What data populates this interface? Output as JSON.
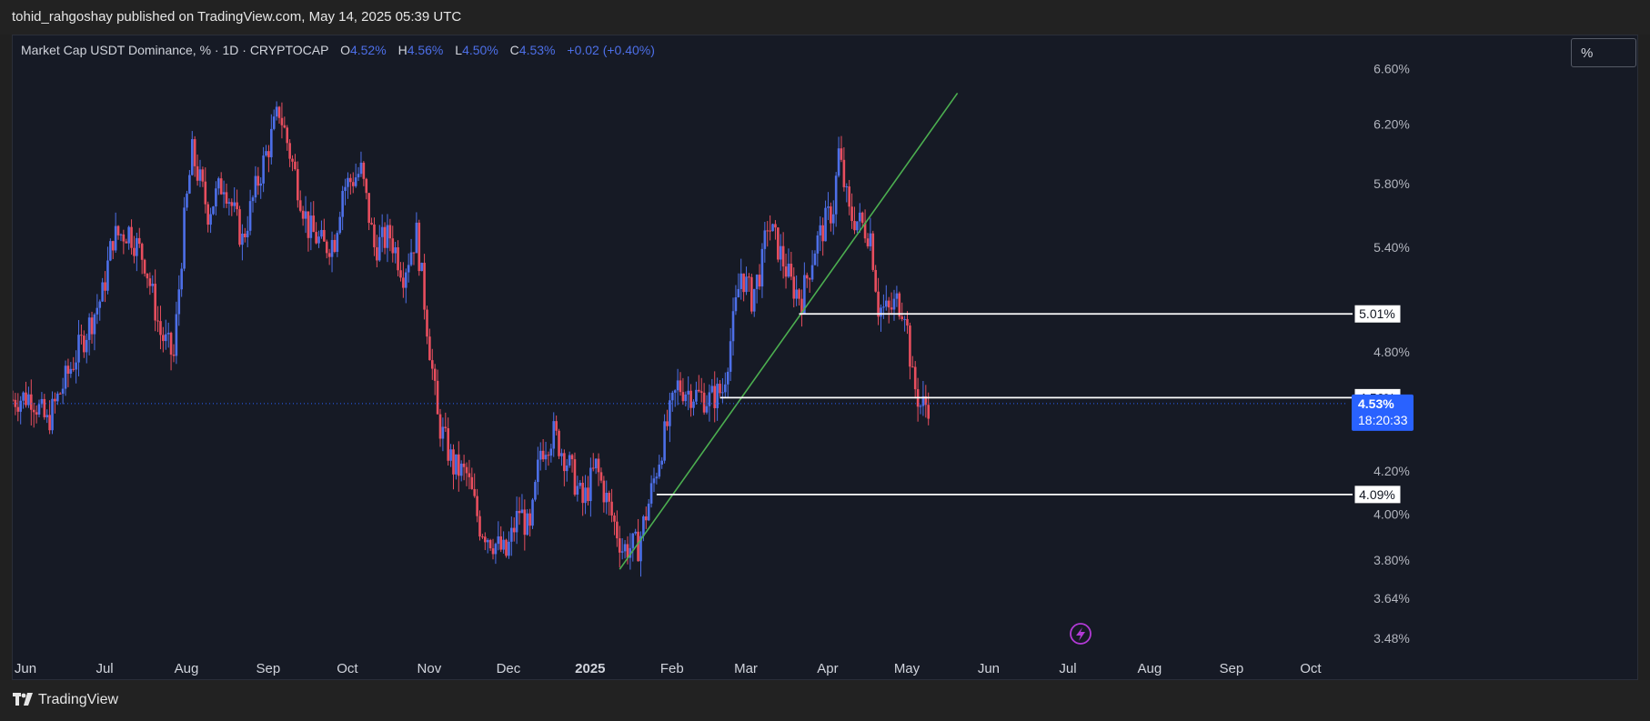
{
  "header": {
    "published": "tohid_rahgoshay published on TradingView.com, May 14, 2025 05:39 UTC"
  },
  "legend": {
    "symbol": "Market Cap USDT Dominance, % · 1D · CRYPTOCAP",
    "open_label": "O",
    "open": "4.52%",
    "high_label": "H",
    "high": "4.56%",
    "low_label": "L",
    "low": "4.50%",
    "close_label": "C",
    "close": "4.53%",
    "change": "+0.02 (+0.40%)"
  },
  "scale_button": "%",
  "footer": {
    "brand": "TradingView"
  },
  "colors": {
    "up": "#4d6fe8",
    "down": "#e84e5e",
    "trendline": "#4caf50",
    "level_line": "#ffffff",
    "background": "#161a25",
    "price_badge": "#2962ff"
  },
  "icons": {
    "alert": "lightning-icon",
    "logo": "tradingview-logo-icon"
  },
  "chart_data": {
    "type": "candlestick",
    "title": "Market Cap USDT Dominance, % · 1D · CRYPTOCAP",
    "x_axis": {
      "ticks": [
        "Jun",
        "Jul",
        "Aug",
        "Sep",
        "Oct",
        "Nov",
        "Dec",
        "2025",
        "Feb",
        "Mar",
        "Apr",
        "May",
        "Jun",
        "Jul",
        "Aug",
        "Sep",
        "Oct"
      ],
      "range": [
        "2024-06-01",
        "2025-10-20"
      ]
    },
    "y_axis": {
      "scale": "log",
      "unit": "%",
      "ticks": [
        "6.60%",
        "6.20%",
        "5.80%",
        "5.40%",
        "4.80%",
        "4.48%",
        "4.20%",
        "4.00%",
        "3.80%",
        "3.64%",
        "3.48%"
      ],
      "range": [
        3.42,
        6.85
      ]
    },
    "series": [
      {
        "name": "Market Cap USDT Dominance",
        "points": [
          [
            "2024-06-01",
            4.55
          ],
          [
            "2024-06-08",
            4.57
          ],
          [
            "2024-06-14",
            4.43
          ],
          [
            "2024-06-20",
            4.62
          ],
          [
            "2024-06-28",
            4.88
          ],
          [
            "2024-07-05",
            5.12
          ],
          [
            "2024-07-09",
            5.46
          ],
          [
            "2024-07-15",
            5.5
          ],
          [
            "2024-07-21",
            5.32
          ],
          [
            "2024-07-27",
            4.9
          ],
          [
            "2024-08-01",
            4.77
          ],
          [
            "2024-08-05",
            5.55
          ],
          [
            "2024-08-08",
            6.0
          ],
          [
            "2024-08-14",
            5.62
          ],
          [
            "2024-08-20",
            5.82
          ],
          [
            "2024-08-27",
            5.44
          ],
          [
            "2024-09-02",
            5.82
          ],
          [
            "2024-09-06",
            6.05
          ],
          [
            "2024-09-10",
            6.3
          ],
          [
            "2024-09-15",
            5.93
          ],
          [
            "2024-09-21",
            5.52
          ],
          [
            "2024-09-27",
            5.4
          ],
          [
            "2024-10-01",
            5.45
          ],
          [
            "2024-10-04",
            5.77
          ],
          [
            "2024-10-11",
            5.88
          ],
          [
            "2024-10-16",
            5.4
          ],
          [
            "2024-10-22",
            5.47
          ],
          [
            "2024-10-27",
            5.25
          ],
          [
            "2024-11-01",
            5.48
          ],
          [
            "2024-11-05",
            4.95
          ],
          [
            "2024-11-09",
            4.45
          ],
          [
            "2024-11-15",
            4.22
          ],
          [
            "2024-11-20",
            4.18
          ],
          [
            "2024-11-25",
            3.95
          ],
          [
            "2024-11-30",
            3.88
          ],
          [
            "2024-12-05",
            3.82
          ],
          [
            "2024-12-10",
            4.02
          ],
          [
            "2024-12-14",
            3.91
          ],
          [
            "2024-12-18",
            4.3
          ],
          [
            "2024-12-23",
            4.38
          ],
          [
            "2024-12-29",
            4.22
          ],
          [
            "2025-01-03",
            4.05
          ],
          [
            "2025-01-08",
            4.22
          ],
          [
            "2025-01-13",
            4.03
          ],
          [
            "2025-01-18",
            3.85
          ],
          [
            "2025-01-24",
            3.86
          ],
          [
            "2025-01-28",
            4.05
          ],
          [
            "2025-02-02",
            4.32
          ],
          [
            "2025-02-08",
            4.62
          ],
          [
            "2025-02-14",
            4.58
          ],
          [
            "2025-02-20",
            4.55
          ],
          [
            "2025-02-25",
            4.6
          ],
          [
            "2025-03-01",
            4.95
          ],
          [
            "2025-03-04",
            5.25
          ],
          [
            "2025-03-08",
            5.1
          ],
          [
            "2025-03-12",
            5.3
          ],
          [
            "2025-03-14",
            5.55
          ],
          [
            "2025-03-18",
            5.4
          ],
          [
            "2025-03-23",
            5.18
          ],
          [
            "2025-03-27",
            5.1
          ],
          [
            "2025-04-01",
            5.4
          ],
          [
            "2025-04-05",
            5.55
          ],
          [
            "2025-04-08",
            5.65
          ],
          [
            "2025-04-10",
            6.0
          ],
          [
            "2025-04-14",
            5.6
          ],
          [
            "2025-04-18",
            5.55
          ],
          [
            "2025-04-22",
            5.48
          ],
          [
            "2025-04-25",
            5.05
          ],
          [
            "2025-04-29",
            5.02
          ],
          [
            "2025-05-02",
            5.08
          ],
          [
            "2025-05-05",
            5.05
          ],
          [
            "2025-05-08",
            4.65
          ],
          [
            "2025-05-11",
            4.52
          ],
          [
            "2025-05-14",
            4.53
          ]
        ]
      }
    ],
    "horizontal_levels": [
      {
        "label": "5.01%",
        "value": 5.01,
        "from": "2025-03-26"
      },
      {
        "label": "4.56%",
        "value": 4.56,
        "from": "2025-02-24"
      },
      {
        "label": "4.09%",
        "value": 4.09,
        "from": "2025-01-31"
      }
    ],
    "trendline": {
      "from": [
        "2025-01-17",
        3.76
      ],
      "to": [
        "2025-05-25",
        6.42
      ]
    },
    "last_price": {
      "value": 4.53,
      "label": "4.53%",
      "countdown": "18:20:33"
    },
    "grid": false,
    "legend_position": "top-left"
  }
}
